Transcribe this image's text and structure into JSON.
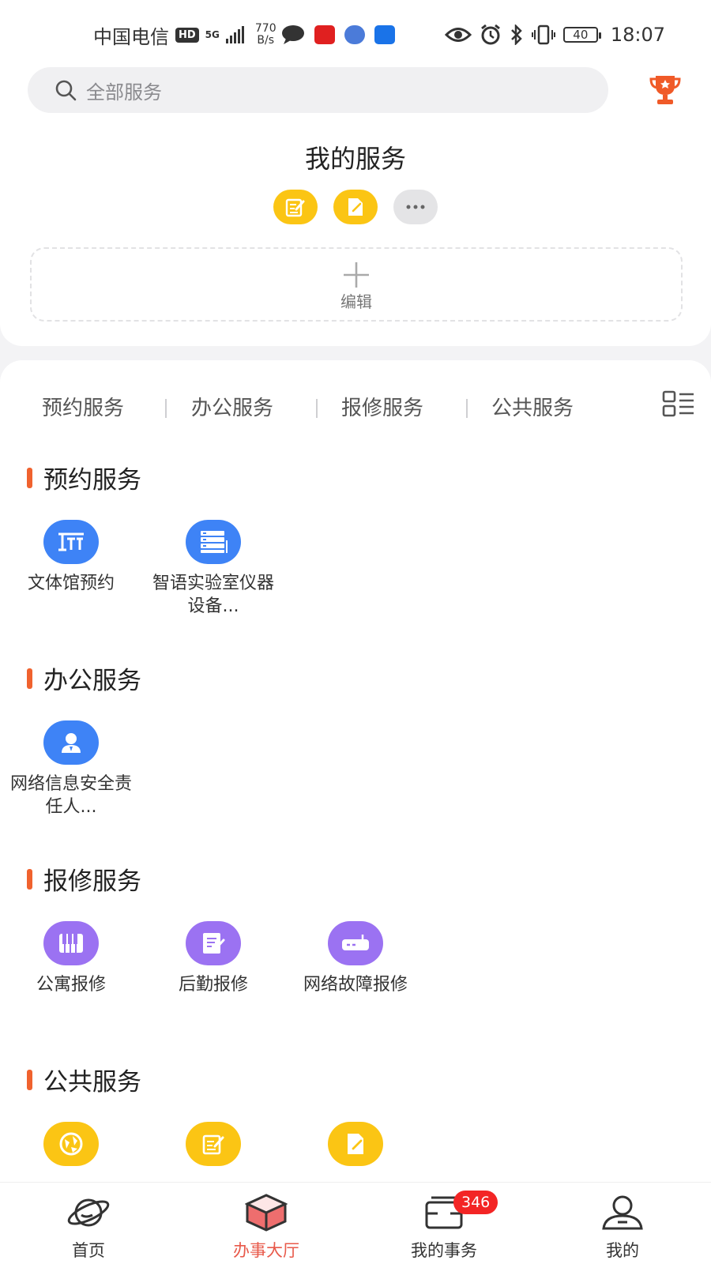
{
  "status_bar": {
    "carrier": "中国电信",
    "hd": "HD",
    "network": "5G",
    "speed_value": "770",
    "speed_unit": "B/s",
    "battery": "40",
    "time": "18:07"
  },
  "search": {
    "placeholder": "全部服务"
  },
  "my_services": {
    "title": "我的服务",
    "edit_label": "编辑"
  },
  "tabs": [
    "预约服务",
    "办公服务",
    "报修服务",
    "公共服务"
  ],
  "sections": [
    {
      "title": "预约服务",
      "items": [
        {
          "label": "文体馆预约",
          "icon": "gym-icon",
          "color": "#3e83f6"
        },
        {
          "label": "智语实验室仪器设备...",
          "icon": "lab-server-icon",
          "color": "#3e83f6"
        }
      ]
    },
    {
      "title": "办公服务",
      "items": [
        {
          "label": "网络信息安全责任人...",
          "icon": "person-icon",
          "color": "#3e83f6"
        }
      ]
    },
    {
      "title": "报修服务",
      "items": [
        {
          "label": "公寓报修",
          "icon": "piano-keys-icon",
          "color": "#9b72f2"
        },
        {
          "label": "后勤报修",
          "icon": "document-edit-icon",
          "color": "#9b72f2"
        },
        {
          "label": "网络故障报修",
          "icon": "router-icon",
          "color": "#9b72f2"
        }
      ]
    },
    {
      "title": "公共服务",
      "items": [
        {
          "icon": "globe-icon",
          "color": "#fbc514"
        },
        {
          "icon": "form-edit-icon",
          "color": "#fbc514"
        },
        {
          "icon": "file-edit-icon",
          "color": "#fbc514"
        }
      ]
    }
  ],
  "bottom_nav": [
    {
      "label": "首页",
      "icon": "planet-icon"
    },
    {
      "label": "办事大厅",
      "icon": "cube-icon",
      "active": true
    },
    {
      "label": "我的事务",
      "icon": "inbox-icon",
      "badge": "346"
    },
    {
      "label": "我的",
      "icon": "user-icon"
    }
  ],
  "colors": {
    "accent": "#e8594a",
    "section_bar": "#f0622e",
    "blue": "#3e83f6",
    "purple": "#9b72f2",
    "yellow": "#fbc514",
    "badge": "#f32525"
  }
}
